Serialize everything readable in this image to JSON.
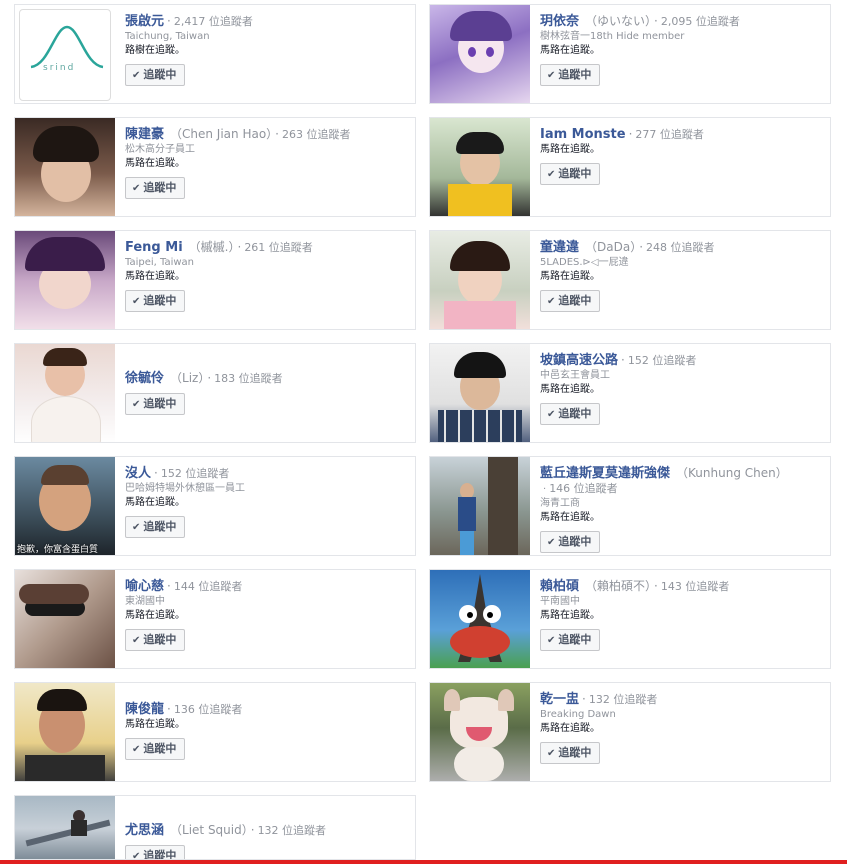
{
  "ui": {
    "follower_suffix": "位追蹤者",
    "following_label": "追蹤中"
  },
  "cards": [
    {
      "name": "張啟元",
      "alt": "",
      "followers": "2,417",
      "followers_text": "2,417 位追蹤者",
      "sub": "Taichung, Taiwan",
      "mutual": "路樹在追蹤。",
      "button": "追蹤中",
      "avatar": "avatar-logo-srind"
    },
    {
      "name": "玥依奈",
      "alt": "（ゆいない）",
      "followers": "2,095",
      "followers_text": "2,095 位追蹤者",
      "sub": "樹林弦音一18th Hide member",
      "mutual": "馬路在追蹤。",
      "button": "追蹤中",
      "avatar": "avatar-anime-girl"
    },
    {
      "name": "陳建豪",
      "alt": "（Chen Jian Hao）",
      "followers": "263",
      "followers_text": "263 位追蹤者",
      "sub": "松木高分子員工",
      "mutual": "馬路在追蹤。",
      "button": "追蹤中",
      "avatar": "avatar-boy-selfie"
    },
    {
      "name": "Iam Monste",
      "alt": "",
      "followers": "277",
      "followers_text": "277 位追蹤者",
      "sub": "",
      "mutual": "馬路在追蹤。",
      "button": "追蹤中",
      "avatar": "avatar-boy-yellow-shirt"
    },
    {
      "name": "Feng Mi",
      "alt": "（槭槭.）",
      "followers": "261",
      "followers_text": "261 位追蹤者",
      "sub": "Taipei, Taiwan",
      "mutual": "馬路在追蹤。",
      "button": "追蹤中",
      "avatar": "avatar-girl-purple"
    },
    {
      "name": "童違違",
      "alt": "（DaDa）",
      "followers": "248",
      "followers_text": "248 位追蹤者",
      "sub": "5LADES.⊳◁一屁違",
      "mutual": "馬路在追蹤。",
      "button": "追蹤中",
      "avatar": "avatar-girl-hands"
    },
    {
      "name": "徐毓伶",
      "alt": "（Liz）",
      "followers": "183",
      "followers_text": "183 位追蹤者",
      "sub": "",
      "mutual": "",
      "button": "追蹤中",
      "avatar": "avatar-girl-teddy"
    },
    {
      "name": "坡鎮高速公路",
      "alt": "",
      "followers": "152",
      "followers_text": "152 位追蹤者",
      "sub": "中邑玄王會員工",
      "mutual": "馬路在追蹤。",
      "button": "追蹤中",
      "avatar": "avatar-boy-plaid"
    },
    {
      "name": "沒人",
      "alt": "",
      "followers": "152",
      "followers_text": "152 位追蹤者",
      "sub": "巴哈姆特場外休憩區一員工",
      "mutual": "馬路在追蹤。",
      "button": "追蹤中",
      "avatar": "avatar-man-smile",
      "caption": "抱歉，你富含蛋白質"
    },
    {
      "name": "藍丘違斯夏莫違斯強傑",
      "alt": "（Kunhung Chen）",
      "followers": "146",
      "followers_text": "146 位追蹤者",
      "sub": "海青工商",
      "mutual": "馬路在追蹤。",
      "button": "追蹤中",
      "avatar": "avatar-boy-street"
    },
    {
      "name": "喻心慈",
      "alt": "",
      "followers": "144",
      "followers_text": "144 位追蹤者",
      "sub": "東湖國中",
      "mutual": "馬路在追蹤。",
      "button": "追蹤中",
      "avatar": "avatar-sunglasses"
    },
    {
      "name": "賴柏碩",
      "alt": "（賴柏碩不）",
      "followers": "143",
      "followers_text": "143 位追蹤者",
      "sub": "平南國中",
      "mutual": "馬路在追蹤。",
      "button": "追蹤中",
      "avatar": "avatar-eiffel-face"
    },
    {
      "name": "陳俊龍",
      "alt": "",
      "followers": "136",
      "followers_text": "136 位追蹤者",
      "sub": "",
      "mutual": "馬路在追蹤。",
      "button": "追蹤中",
      "avatar": "avatar-man-portrait"
    },
    {
      "name": "乾一盅",
      "alt": "",
      "followers": "132",
      "followers_text": "132 位追蹤者",
      "sub": "Breaking Dawn",
      "mutual": "馬路在追蹤。",
      "button": "追蹤中",
      "avatar": "avatar-bulldog"
    },
    {
      "name": "尤思涵",
      "alt": "（Liet Squid）",
      "followers": "132",
      "followers_text": "132 位追蹤者",
      "sub": "",
      "mutual": "",
      "button": "追蹤中",
      "avatar": "avatar-skater"
    }
  ]
}
